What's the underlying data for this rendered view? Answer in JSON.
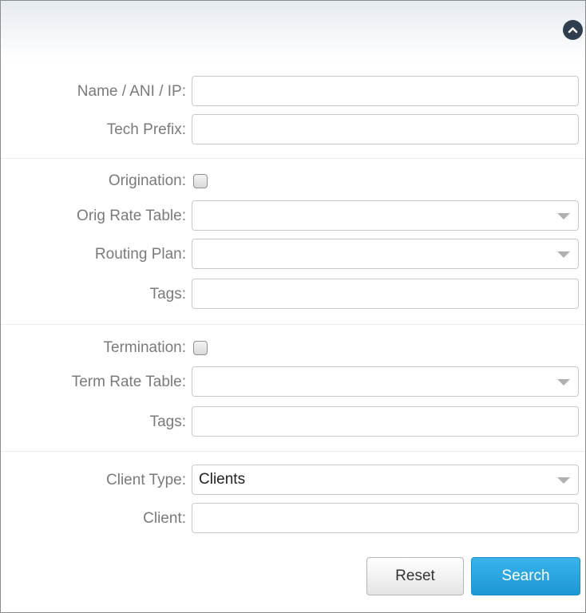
{
  "filter_form": {
    "fields": {
      "name_ani_ip": {
        "label": "Name / ANI / IP:",
        "value": ""
      },
      "tech_prefix": {
        "label": "Tech Prefix:",
        "value": ""
      }
    },
    "origination": {
      "label": "Origination:",
      "checked": false,
      "rate_table": {
        "label": "Orig Rate Table:",
        "value": ""
      },
      "routing_plan": {
        "label": "Routing Plan:",
        "value": ""
      },
      "tags": {
        "label": "Tags:",
        "value": ""
      }
    },
    "termination": {
      "label": "Termination:",
      "checked": false,
      "rate_table": {
        "label": "Term Rate Table:",
        "value": ""
      },
      "tags": {
        "label": "Tags:",
        "value": ""
      }
    },
    "client_type": {
      "label": "Client Type:",
      "value": "Clients"
    },
    "client": {
      "label": "Client:",
      "value": ""
    },
    "buttons": {
      "reset": "Reset",
      "search": "Search"
    }
  },
  "icons": {
    "collapse": "chevron-up-icon",
    "dropdown": "caret-down-icon"
  },
  "colors": {
    "search_button": "#2aa4e0",
    "collapse_button": "#2f3e4f",
    "label_text": "#7a7a7a"
  }
}
